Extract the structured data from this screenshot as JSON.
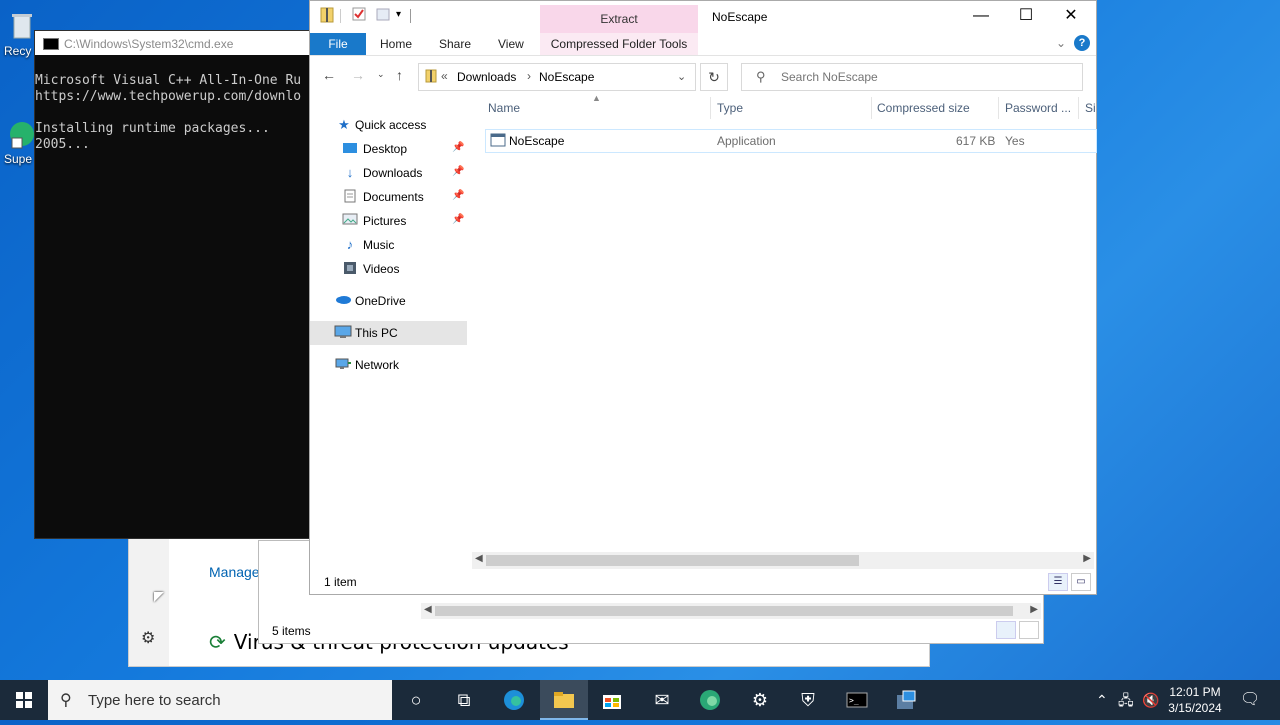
{
  "desktop": {
    "icons": [
      {
        "label": "Recy"
      },
      {
        "label": "Supe"
      }
    ]
  },
  "windows_security": {
    "manage_link": "Manage",
    "section_title": "Virus & threat protection updates"
  },
  "explorer_bg": {
    "status": "5 items"
  },
  "cmd": {
    "title": "C:\\Windows\\System32\\cmd.exe",
    "lines": "Microsoft Visual C++ All-In-One Ru\nhttps://www.techpowerup.com/downlo\n\nInstalling runtime packages...\n2005..."
  },
  "explorer": {
    "title": "NoEscape",
    "contextual_tab": "Extract",
    "ribbon_tabs": {
      "file": "File",
      "home": "Home",
      "share": "Share",
      "view": "View",
      "compressed_tools": "Compressed Folder Tools"
    },
    "address": {
      "overflow": "«",
      "crumbs": [
        "Downloads",
        "NoEscape"
      ]
    },
    "search_placeholder": "Search NoEscape",
    "nav_items": [
      {
        "label": "Quick access",
        "icon": "star-icon"
      },
      {
        "label": "Desktop",
        "icon": "desktop-folder-icon"
      },
      {
        "label": "Downloads",
        "icon": "download-arrow-icon"
      },
      {
        "label": "Documents",
        "icon": "document-icon"
      },
      {
        "label": "Pictures",
        "icon": "pictures-icon"
      },
      {
        "label": "Music",
        "icon": "music-note-icon"
      },
      {
        "label": "Videos",
        "icon": "video-icon"
      },
      {
        "label": "OneDrive",
        "icon": "cloud-icon"
      },
      {
        "label": "This PC",
        "icon": "computer-icon"
      },
      {
        "label": "Network",
        "icon": "network-icon"
      }
    ],
    "columns": {
      "name": "Name",
      "type": "Type",
      "compressed_size": "Compressed size",
      "password": "Password ...",
      "size": "Si"
    },
    "files": [
      {
        "name": "NoEscape",
        "type": "Application",
        "compressed_size": "617 KB",
        "password": "Yes"
      }
    ],
    "status": "1 item"
  },
  "taskbar": {
    "search_placeholder": "Type here to search",
    "time": "12:01 PM",
    "date": "3/15/2024"
  },
  "colors": {
    "accent": "#1979ca",
    "extract_tab": "#f9d7ea",
    "taskbar": "#1b2a3a"
  }
}
